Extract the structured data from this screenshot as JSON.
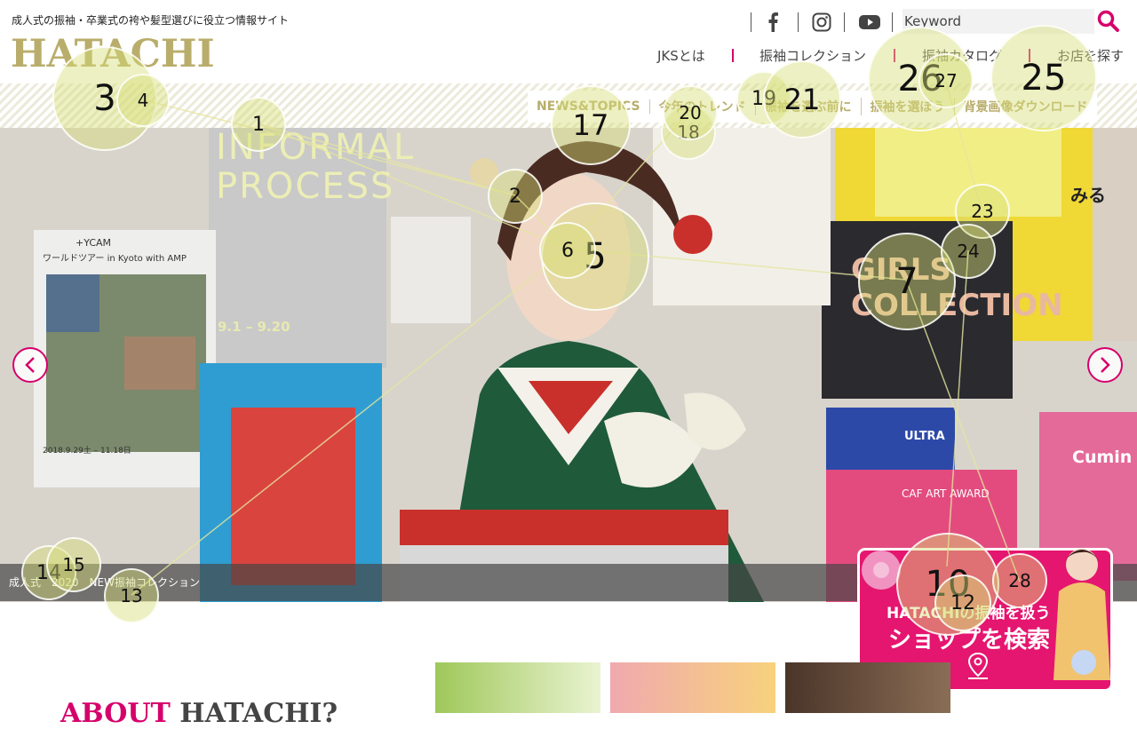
{
  "header": {
    "tagline": "成人式の振袖・卒業式の袴や髪型選びに役立つ情報サイト",
    "logo": "HATACHI",
    "search_placeholder": "Keyword",
    "social": [
      "facebook-icon",
      "instagram-icon",
      "youtube-icon"
    ]
  },
  "mainnav": [
    "JKSとは",
    "振袖コレクション",
    "振袖カタログ",
    "お店を探す"
  ],
  "subnav": [
    "NEWS&TOPICS",
    "今年のトレンド",
    "振袖を選ぶ前に",
    "振袖を選ぼう",
    "背景画像ダウンロード"
  ],
  "hero": {
    "caption": "成人式　2020　NEW振袖コレクション",
    "prev": "‹",
    "next": "›",
    "poster_texts": {
      "informal": "INFORMAL PROCESS",
      "ycam_title": "+YCAM",
      "ycam_sub": "ワールドツアー in Kyoto with AMP",
      "ycam_date": "2018.9.29土 – 11.18日",
      "ultra": "ULTRA",
      "ultra_sub": "GIRLS COLLECTION",
      "caf": "CAF ART AWARD",
      "cumin": "Cumin",
      "miru": "みる",
      "date_range": "9.1 – 9.20"
    }
  },
  "shop_card": {
    "line1": "HATACHIの振袖を扱う",
    "line2": "ショップを検索"
  },
  "about": {
    "word1": "ABOUT",
    "word2": "HATACHI?"
  },
  "markers": [
    "1",
    "2",
    "3",
    "4",
    "5",
    "6",
    "7",
    "10",
    "12",
    "13",
    "14",
    "15",
    "17",
    "18",
    "19",
    "20",
    "21",
    "23",
    "24",
    "25",
    "26",
    "27",
    "28"
  ],
  "colors": {
    "brand_gold": "#b9ad6b",
    "accent_pink": "#d6006b",
    "shop_pink": "#e5166f"
  }
}
